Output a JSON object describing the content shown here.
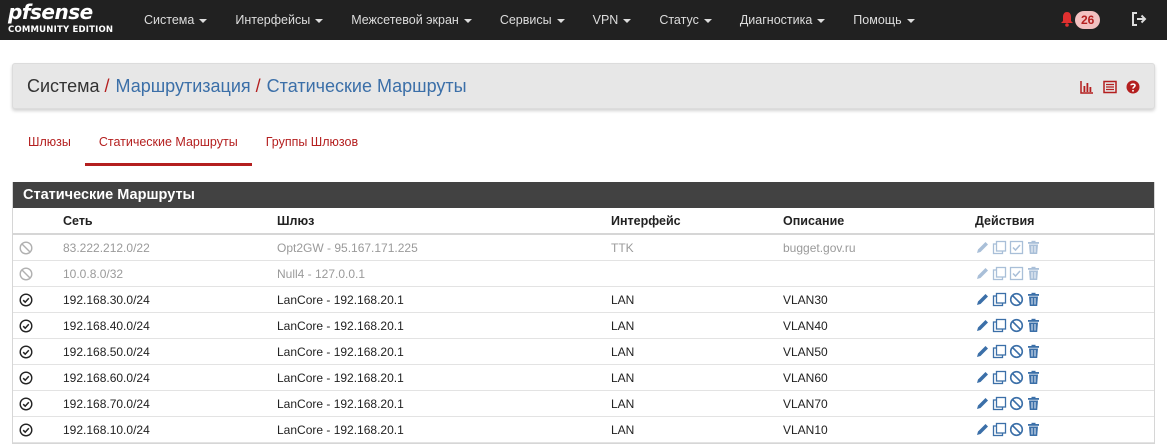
{
  "brand": {
    "logo_main": "pfsense",
    "logo_sub": "COMMUNITY EDITION"
  },
  "nav": {
    "items": [
      {
        "label": "Система"
      },
      {
        "label": "Интерфейсы"
      },
      {
        "label": "Межсетевой экран"
      },
      {
        "label": "Сервисы"
      },
      {
        "label": "VPN"
      },
      {
        "label": "Статус"
      },
      {
        "label": "Диагностика"
      },
      {
        "label": "Помощь"
      }
    ],
    "notifications_count": "26",
    "bell_icon": "bell-icon",
    "logout_icon": "sign-out-icon"
  },
  "breadcrumb": {
    "root": "Система",
    "sep": "/",
    "level1": "Маршрутизация",
    "level2": "Статические Маршруты",
    "icons": [
      "chart-icon",
      "list-icon",
      "help-icon"
    ]
  },
  "tabs": [
    {
      "label": "Шлюзы",
      "active": false
    },
    {
      "label": "Статические Маршруты",
      "active": true
    },
    {
      "label": "Группы Шлюзов",
      "active": false
    }
  ],
  "panel": {
    "title": "Статические Маршруты",
    "columns": {
      "network": "Сеть",
      "gateway": "Шлюз",
      "interface": "Интерфейс",
      "description": "Описание",
      "actions": "Действия"
    },
    "rows": [
      {
        "enabled": false,
        "network": "83.222.212.0/22",
        "gateway": "Opt2GW - 95.167.171.225",
        "interface": "TTK",
        "description": "bugget.gov.ru"
      },
      {
        "enabled": false,
        "network": "10.0.8.0/32",
        "gateway": "Null4 - 127.0.0.1",
        "interface": "",
        "description": ""
      },
      {
        "enabled": true,
        "network": "192.168.30.0/24",
        "gateway": "LanCore - 192.168.20.1",
        "interface": "LAN",
        "description": "VLAN30"
      },
      {
        "enabled": true,
        "network": "192.168.40.0/24",
        "gateway": "LanCore - 192.168.20.1",
        "interface": "LAN",
        "description": "VLAN40"
      },
      {
        "enabled": true,
        "network": "192.168.50.0/24",
        "gateway": "LanCore - 192.168.20.1",
        "interface": "LAN",
        "description": "VLAN50"
      },
      {
        "enabled": true,
        "network": "192.168.60.0/24",
        "gateway": "LanCore - 192.168.20.1",
        "interface": "LAN",
        "description": "VLAN60"
      },
      {
        "enabled": true,
        "network": "192.168.70.0/24",
        "gateway": "LanCore - 192.168.20.1",
        "interface": "LAN",
        "description": "VLAN70"
      },
      {
        "enabled": true,
        "network": "192.168.10.0/24",
        "gateway": "LanCore - 192.168.20.1",
        "interface": "LAN",
        "description": "VLAN10"
      }
    ]
  },
  "colors": {
    "navbar_bg": "#212121",
    "accent_red": "#b41f1f",
    "link_blue": "#3b6fa8",
    "action_blue": "#3b6fa8",
    "disabled_grey": "#9a9a9a"
  }
}
